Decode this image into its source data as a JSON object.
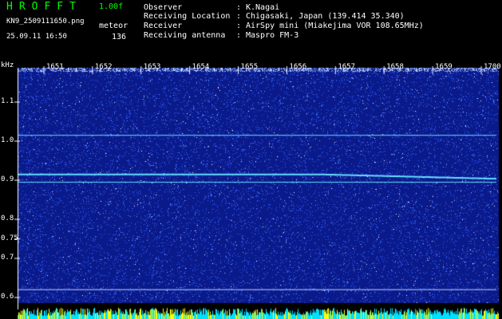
{
  "app": {
    "title": "HROFFT",
    "version": "1.00f",
    "file_name": "KN9_2509111650.png",
    "date_time": "25.09.11 16:50",
    "mode": "meteor",
    "count": "136"
  },
  "meta": [
    {
      "key": "Observer",
      "sep": ":",
      "value": "K.Nagai"
    },
    {
      "key": "Receiving Location",
      "sep": ":",
      "value": "Chigasaki, Japan (139.414 35.340)"
    },
    {
      "key": "Receiver",
      "sep": ":",
      "value": "AirSpy mini (Miakejima VOR 108.65MHz)"
    },
    {
      "key": "Receiving antenna",
      "sep": ":",
      "value": "Maspro FM-3"
    }
  ],
  "chart_data": {
    "type": "heatmap",
    "ylabel": "kHz",
    "x_ticks": [
      "1651",
      "1652",
      "1653",
      "1654",
      "1655",
      "1656",
      "1657",
      "1658",
      "1659",
      "1700"
    ],
    "y_ticks": [
      "1.1",
      "1.0",
      "0.9",
      "0.8",
      "0.75",
      "0.7",
      "0.6"
    ],
    "ylim": [
      0.6,
      1.15
    ],
    "lines_khz": [
      1.015,
      0.915,
      0.895,
      0.62
    ]
  },
  "colors": {
    "background": "#0b1a8a",
    "noise": "#2a5cff",
    "carrier": "#66e0ff",
    "accent_green": "#00ff00"
  }
}
